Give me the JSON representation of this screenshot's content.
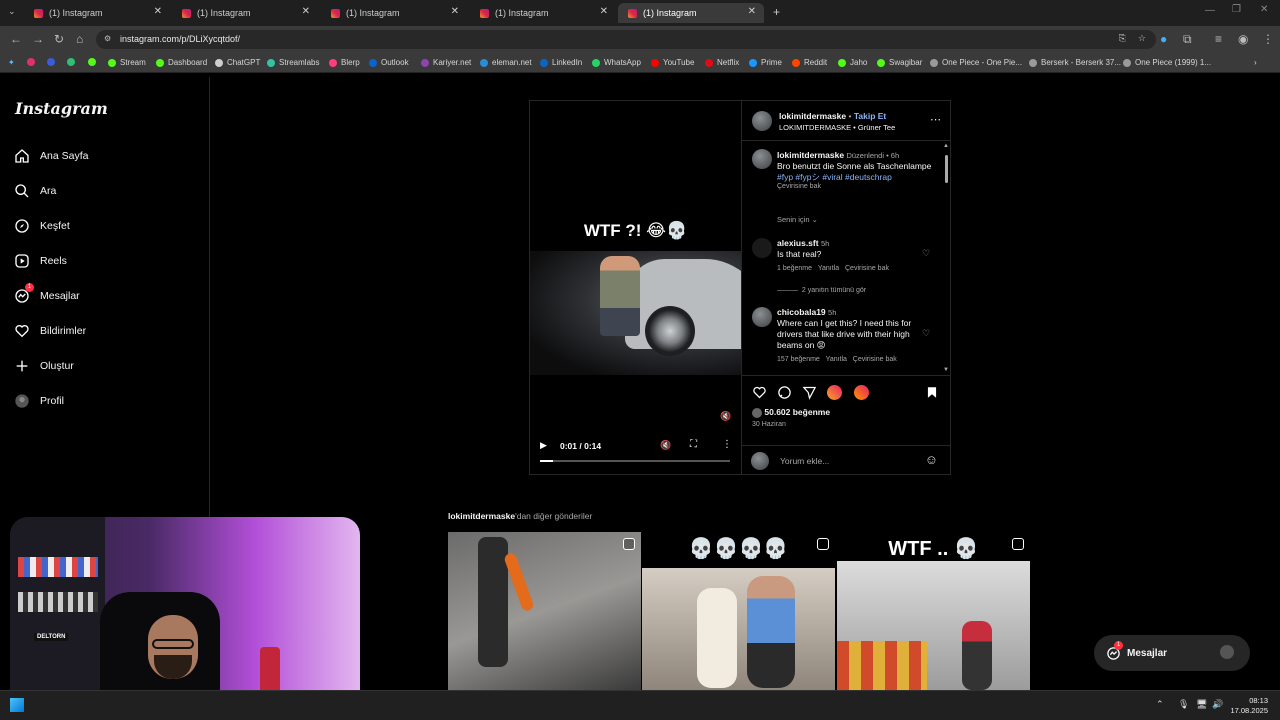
{
  "browser": {
    "tabs": [
      {
        "label": "(1) Instagram"
      },
      {
        "label": "(1) Instagram"
      },
      {
        "label": "(1) Instagram"
      },
      {
        "label": "(1) Instagram"
      },
      {
        "label": "(1) Instagram"
      }
    ],
    "new_tab": "+",
    "url": "instagram.com/p/DLiXycqtdof/",
    "bookmarks": [
      "Stream",
      "Dashboard",
      "ChatGPT",
      "Streamlabs",
      "Blerp",
      "Outlook",
      "Kariyer.net",
      "eleman.net",
      "LinkedIn",
      "WhatsApp",
      "YouTube",
      "Netflix",
      "Prime",
      "Reddit",
      "Jaho",
      "Swagibar",
      "One Piece - One Pie...",
      "Berserk - Berserk 37...",
      "One Piece (1999) 1..."
    ]
  },
  "sidebar": {
    "logo": "Instagram",
    "items": [
      {
        "label": "Ana Sayfa"
      },
      {
        "label": "Ara"
      },
      {
        "label": "Keşfet"
      },
      {
        "label": "Reels"
      },
      {
        "label": "Mesajlar",
        "badge": "1"
      },
      {
        "label": "Bildirimler"
      },
      {
        "label": "Oluştur"
      },
      {
        "label": "Profil"
      }
    ]
  },
  "post": {
    "video_overlay": "WTF ?! 😂💀",
    "time": "0:01 / 0:14",
    "progress": 0.07,
    "author": "lokimitdermaske",
    "follow": "Takip Et",
    "audio": "LOKIMITDERMASKE • Grüner Tee",
    "caption": {
      "user": "lokimitdermaske",
      "edited": "Düzenlendi",
      "time": "6h",
      "text": "Bro benutzt die Sonne als Taschenlampe",
      "tags": "#fyp #fypシ #viral #deutschrap",
      "translate": "Çevirisine bak"
    },
    "sort": "Senin için",
    "comments": [
      {
        "user": "alexius.sft",
        "time": "5h",
        "text": "Is that real?",
        "likes": "1 beğenme",
        "reply": "Yanıtla",
        "translate": "Çevirisine bak",
        "replies": "2 yanıtın tümünü gör"
      },
      {
        "user": "chicobala19",
        "time": "5h",
        "text": "Where can I get this? I need this for drivers that like drive with their high beams on 😡",
        "likes": "157 beğenme",
        "reply": "Yanıtla",
        "translate": "Çevirisine bak"
      }
    ],
    "like_count": "50.602 beğenme",
    "date": "30 Haziran",
    "comment_placeholder": "Yorum ekle..."
  },
  "more": {
    "title_user": "lokimitdermaske",
    "title_rest": "'dan diğer gönderiler",
    "thumbs": [
      {
        "overlay": ""
      },
      {
        "overlay": "💀💀💀💀"
      },
      {
        "overlay": "WTF .. 💀"
      }
    ]
  },
  "messages_float": {
    "label": "Mesajlar",
    "badge": "1"
  },
  "taskbar": {
    "time": "08:13",
    "date": "17.08.2025"
  },
  "webcam": {
    "sign": "DELTORN"
  }
}
